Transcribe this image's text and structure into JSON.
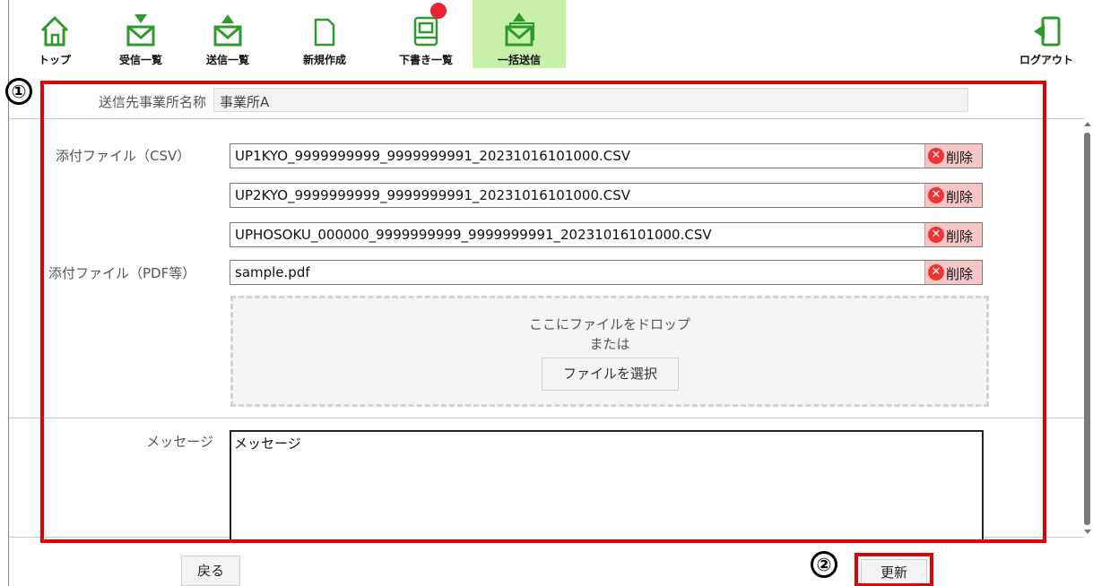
{
  "toolbar": {
    "items": [
      {
        "label": "トップ",
        "icon": "home-icon"
      },
      {
        "label": "受信一覧",
        "icon": "inbox-icon"
      },
      {
        "label": "送信一覧",
        "icon": "outbox-icon"
      },
      {
        "label": "新規作成",
        "icon": "new-document-icon"
      },
      {
        "label": "下書き一覧",
        "icon": "drafts-icon"
      },
      {
        "label": "一括送信",
        "icon": "bulk-send-icon"
      }
    ],
    "logout_label": "ログアウト",
    "active_item": "一括送信",
    "accent_color": "#c9f0a8",
    "icon_color": "#2e9a2e",
    "badge_color": "#ee2233"
  },
  "form": {
    "destination": {
      "label": "送信先事業所名称",
      "value": "事業所A"
    },
    "csv": {
      "label": "添付ファイル（CSV）",
      "files": [
        "UP1KYO_9999999999_9999999991_20231016101000.CSV",
        "UP2KYO_9999999999_9999999991_20231016101000.CSV",
        "UPHOSOKU_000000_9999999999_9999999991_20231016101000.CSV"
      ]
    },
    "pdf": {
      "label": "添付ファイル（PDF等）",
      "files": [
        "sample.pdf"
      ]
    },
    "delete_label": "削除",
    "dropzone": {
      "line1": "ここにファイルをドロップ",
      "line2": "または",
      "button": "ファイルを選択"
    },
    "message": {
      "label": "メッセージ",
      "value": "メッセージ"
    }
  },
  "footer": {
    "back_label": "戻る",
    "update_label": "更新"
  },
  "annotations": [
    {
      "number": "①",
      "color": "#e00000"
    },
    {
      "number": "②",
      "color": "#e00000"
    }
  ]
}
